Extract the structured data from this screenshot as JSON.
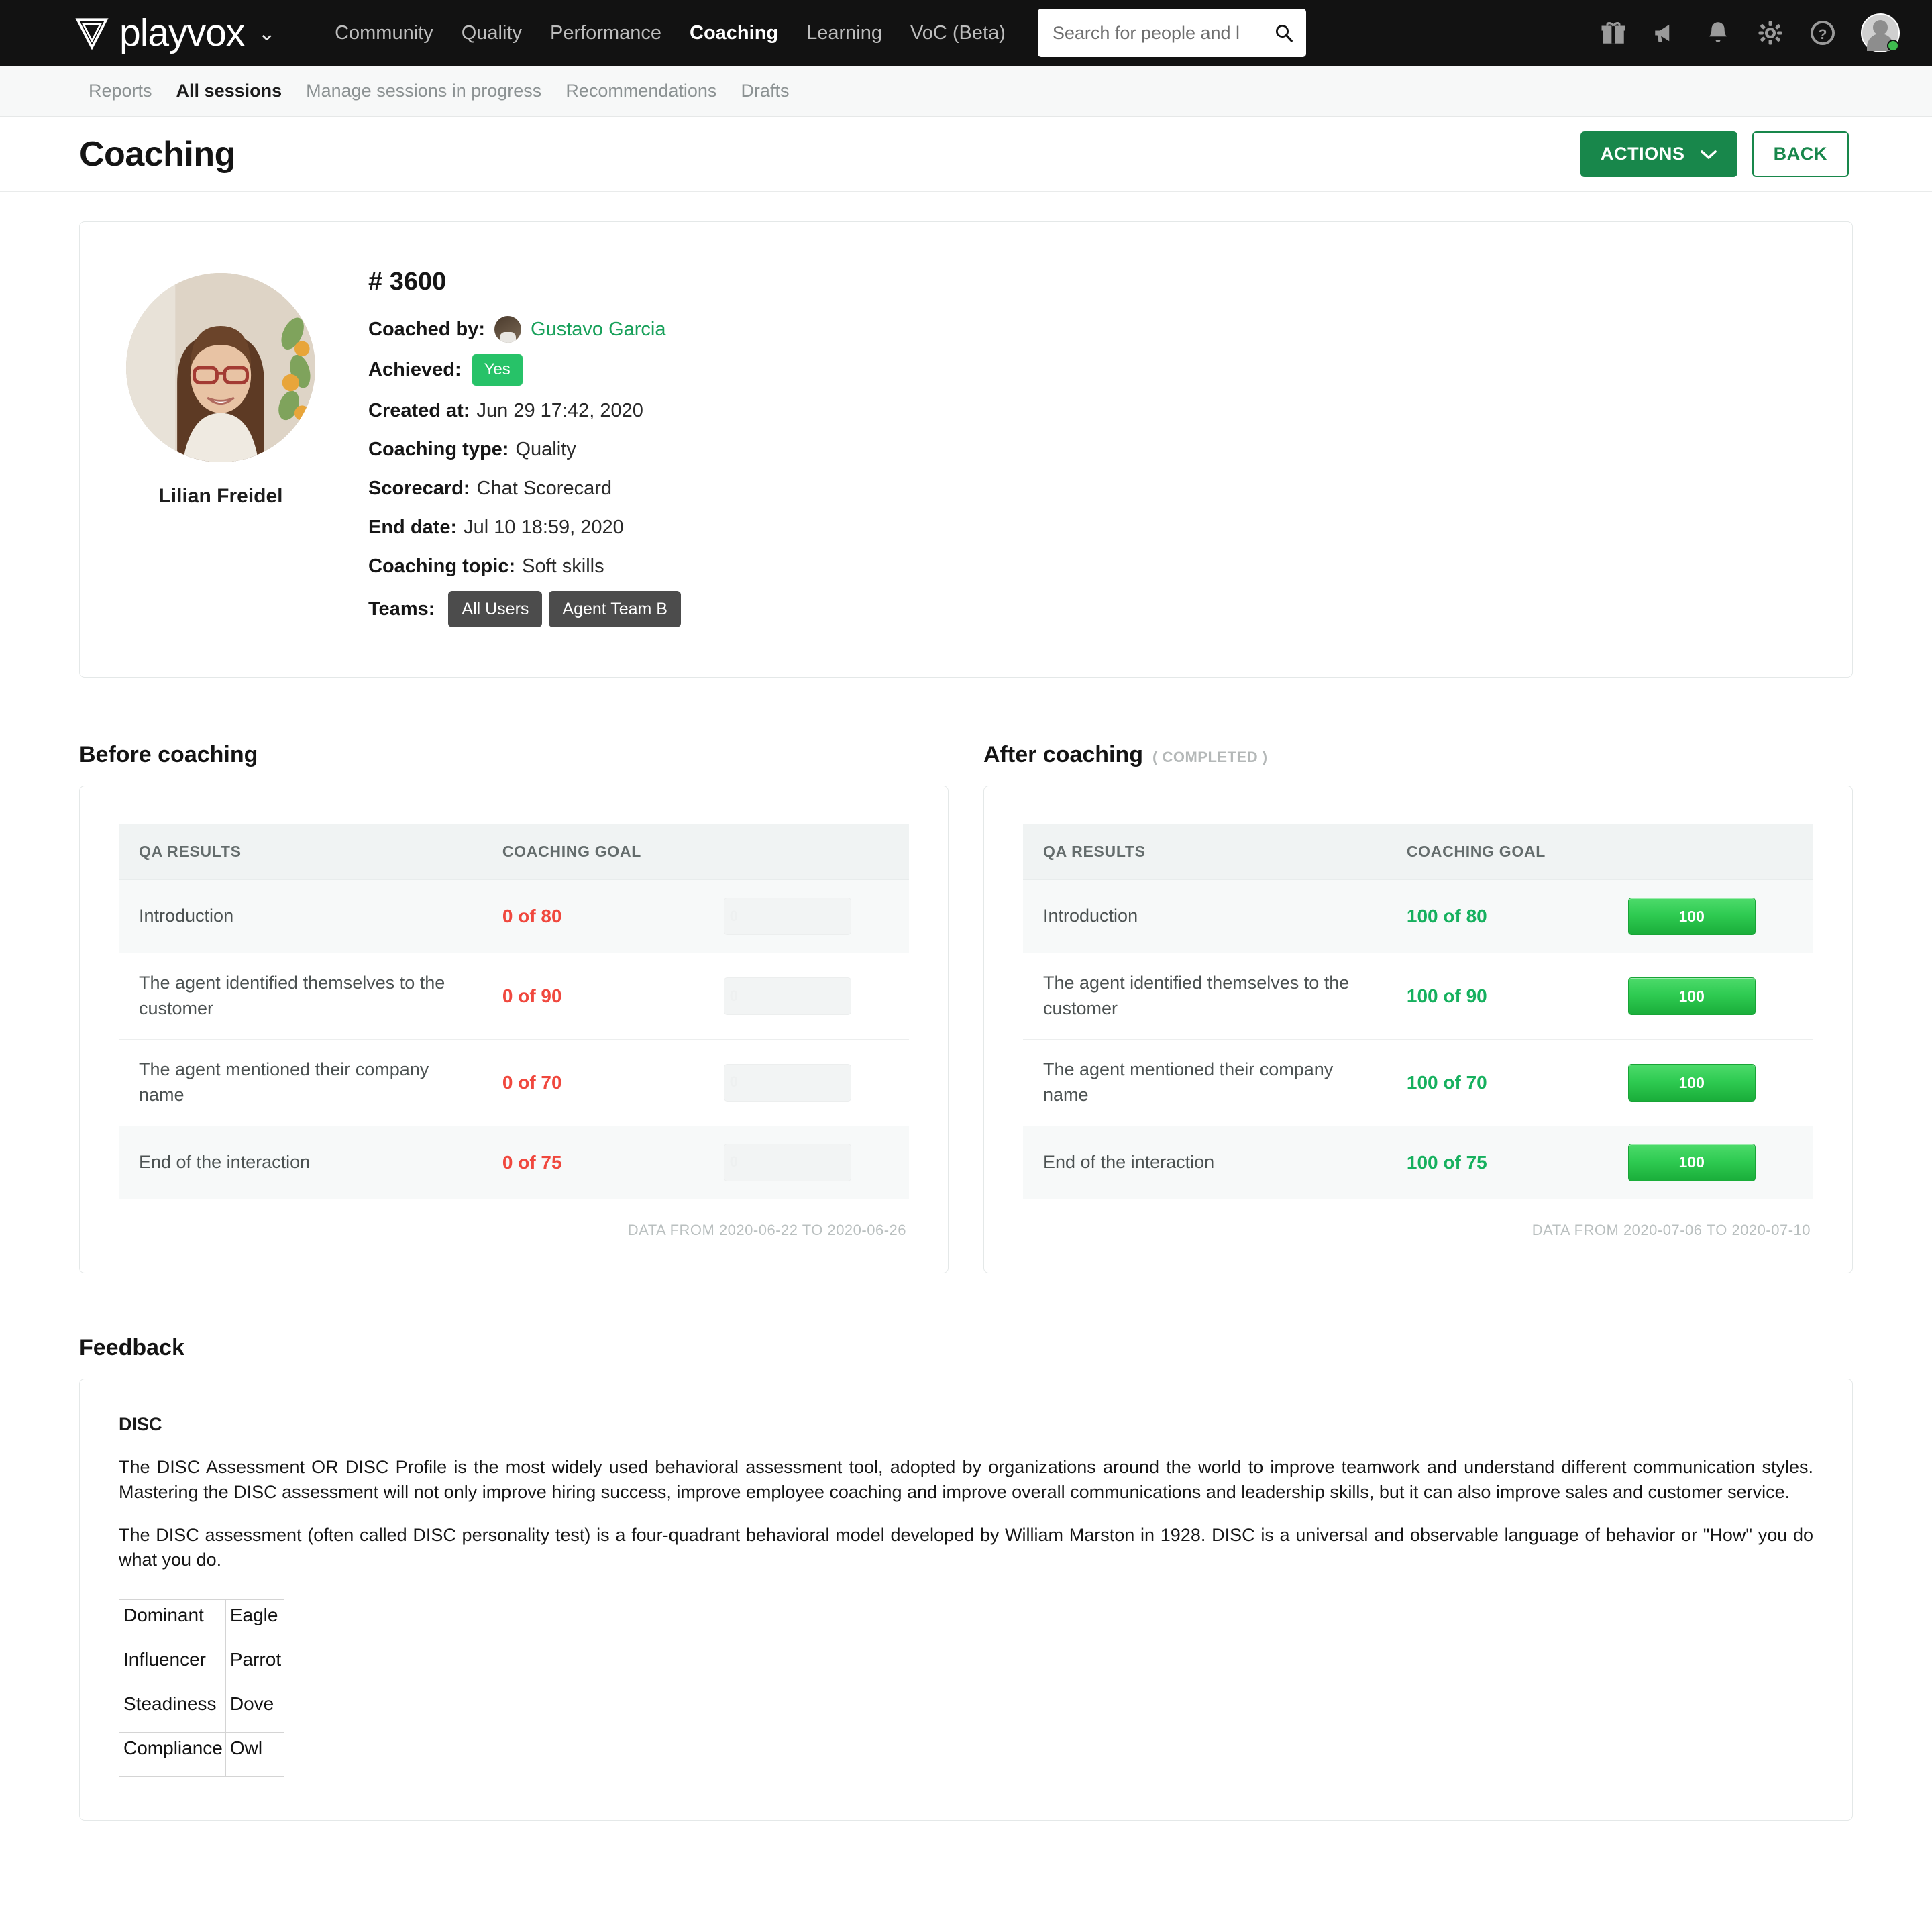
{
  "topnav": {
    "brand": "playvox",
    "brand_caret": "⌄",
    "links": [
      {
        "label": "Community",
        "active": false
      },
      {
        "label": "Quality",
        "active": false
      },
      {
        "label": "Performance",
        "active": false
      },
      {
        "label": "Coaching",
        "active": true
      },
      {
        "label": "Learning",
        "active": false
      },
      {
        "label": "VoC (Beta)",
        "active": false
      }
    ],
    "search": {
      "placeholder": "Search for people and l",
      "value": ""
    },
    "icons": [
      "gift-icon",
      "megaphone-icon",
      "bell-icon",
      "gear-icon",
      "help-icon",
      "avatar"
    ]
  },
  "subnav": {
    "links": [
      {
        "label": "Reports",
        "active": false
      },
      {
        "label": "All sessions",
        "active": true
      },
      {
        "label": "Manage sessions in progress",
        "active": false
      },
      {
        "label": "Recommendations",
        "active": false
      },
      {
        "label": "Drafts",
        "active": false
      }
    ]
  },
  "pagehead": {
    "title": "Coaching",
    "actions_label": "ACTIONS",
    "back_label": "BACK"
  },
  "session": {
    "agent_name": "Lilian Freidel",
    "id": "# 3600",
    "coached_by_label": "Coached by:",
    "coached_by_name": "Gustavo Garcia",
    "achieved_label": "Achieved:",
    "achieved_value": "Yes",
    "created_at_label": "Created at:",
    "created_at_value": "Jun 29 17:42, 2020",
    "coaching_type_label": "Coaching type:",
    "coaching_type_value": "Quality",
    "scorecard_label": "Scorecard:",
    "scorecard_value": "Chat Scorecard",
    "end_date_label": "End date:",
    "end_date_value": "Jul 10 18:59, 2020",
    "coaching_topic_label": "Coaching topic:",
    "coaching_topic_value": "Soft skills",
    "teams_label": "Teams:",
    "teams": [
      "All Users",
      "Agent Team B"
    ]
  },
  "before": {
    "heading": "Before coaching",
    "status": "",
    "columns": [
      "QA RESULTS",
      "COACHING GOAL",
      ""
    ],
    "rows": [
      {
        "name": "Introduction",
        "goal": "0 of 80",
        "bar_value": "0",
        "bar_pct": 0
      },
      {
        "name": "The agent identified themselves to the customer",
        "goal": "0 of 90",
        "bar_value": "0",
        "bar_pct": 0
      },
      {
        "name": "The agent mentioned their company name",
        "goal": "0 of 70",
        "bar_value": "0",
        "bar_pct": 0
      },
      {
        "name": "End of the interaction",
        "goal": "0 of 75",
        "bar_value": "0",
        "bar_pct": 0
      }
    ],
    "data_from": "DATA FROM 2020-06-22 TO 2020-06-26"
  },
  "after": {
    "heading": "After coaching",
    "status": "( COMPLETED )",
    "columns": [
      "QA RESULTS",
      "COACHING GOAL",
      ""
    ],
    "rows": [
      {
        "name": "Introduction",
        "goal": "100 of 80",
        "bar_value": "100",
        "bar_pct": 100
      },
      {
        "name": "The agent identified themselves to the customer",
        "goal": "100 of 90",
        "bar_value": "100",
        "bar_pct": 100
      },
      {
        "name": "The agent mentioned their company name",
        "goal": "100 of 70",
        "bar_value": "100",
        "bar_pct": 100
      },
      {
        "name": "End of the interaction",
        "goal": "100 of 75",
        "bar_value": "100",
        "bar_pct": 100
      }
    ],
    "data_from": "DATA FROM 2020-07-06 TO 2020-07-10"
  },
  "feedback": {
    "heading": "Feedback",
    "title": "DISC",
    "para1": "The DISC Assessment OR DISC Profile is the most widely used behavioral assessment tool, adopted by organizations around the world to improve teamwork and understand different communication styles.  Mastering the DISC assessment will not only improve hiring success, improve employee coaching and improve overall communications and leadership skills, but it can also improve sales and customer service.",
    "para2": "The DISC assessment (often called DISC personality test) is a four-quadrant behavioral model developed by William Marston in 1928. DISC is a universal and observable language of behavior or \"How\" you do what you do.",
    "disc_rows": [
      {
        "trait": "Dominant",
        "bird": "Eagle"
      },
      {
        "trait": "Influencer",
        "bird": "Parrot"
      },
      {
        "trait": "Steadiness",
        "bird": "Dove"
      },
      {
        "trait": "Compliance",
        "bird": "Owl"
      }
    ]
  },
  "colors": {
    "brand_green": "#18874b",
    "accent_green": "#16b05e",
    "danger_red": "#f0483e",
    "nav_dark": "#121212",
    "badge_gray": "#4c4c4c"
  }
}
